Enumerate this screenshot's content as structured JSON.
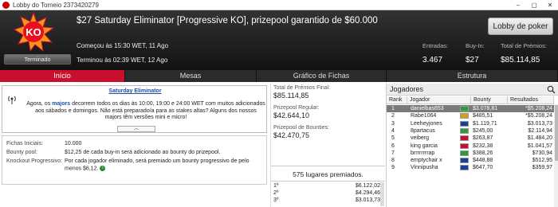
{
  "window": {
    "title": "Lobby do Torneio 2373420279",
    "min": "–",
    "max": "▢",
    "close": "✕"
  },
  "header": {
    "logo_text": "KO",
    "status_label": "Terminado",
    "title": "$27 Saturday Eliminator [Progressive KO], prizepool garantido de $60.000",
    "started": "Começou às 15:30 WET, 11 Ago",
    "ended": "Terminou às 02:39 WET, 12 Ago",
    "entries_label": "Entradas:",
    "entries_value": "3.467",
    "buyin_label": "Buy-In:",
    "buyin_value": "$27",
    "total_label": "Total de Prémios:",
    "total_value": "$85.114,85",
    "lobby_button": "Lobby de poker"
  },
  "tabs": [
    {
      "label": "Início",
      "active": true
    },
    {
      "label": "Mesas",
      "active": false
    },
    {
      "label": "Gráfico de Fichas",
      "active": false
    },
    {
      "label": "Estrutura",
      "active": false
    }
  ],
  "news": {
    "title": "Saturday Eliminator",
    "text_pre": "Agora, os ",
    "text_link": "majors",
    "text_post": " decorrem todos os dias às 10:00, 19:00 e 24:00 WET com muitos adicionados aos sábados e domingos. Não está preparado/a para as stakes altas? Alguns dos nossos majors têm versões mini e micro!",
    "collapse_glyph": "︿"
  },
  "info": {
    "chips_label": "Fichas Iniciais:",
    "chips_value": "10.000",
    "bounty_label": "Bounty pool:",
    "bounty_value": "$12,25 de cada buy-in será adicionado ao bounty do prizepool.",
    "ko_label": "Knockout Progressivo:",
    "ko_value": "Por cada jogador eliminado, será premiado um bounty progressivo de pelo menos $6,12."
  },
  "prizes": {
    "final_label": "Total de Prémios Final:",
    "final_value": "$85.114,85",
    "regular_label": "Prizepool Regular:",
    "regular_value": "$42.644,10",
    "bounties_label": "Prizepool de Bounties:",
    "bounties_value": "$42.470,75",
    "places_text": "575 lugares premiados.",
    "rows": [
      {
        "place": "1º",
        "amount": "$6.122,02"
      },
      {
        "place": "2º",
        "amount": "$4.294,46"
      },
      {
        "place": "3º",
        "amount": "$3.013,73"
      }
    ]
  },
  "players": {
    "panel_title": "Jogadores",
    "columns": [
      "Rank",
      "Jogador",
      "Bounty",
      "Resultados"
    ],
    "rows": [
      {
        "rank": "1",
        "name": "danielbas653",
        "bounty": "$3.078,81",
        "result": "*$5.208,24",
        "flag": "#2a9d3a"
      },
      {
        "rank": "2",
        "name": "Rabe1064",
        "bounty": "$485,51",
        "result": "*$5.208,24",
        "flag": "#d4a017"
      },
      {
        "rank": "3",
        "name": "Leeheyjones",
        "bounty": "$1.119,71",
        "result": "$3.013,73",
        "flag": "#1a3f9a"
      },
      {
        "rank": "4",
        "name": "8partacus",
        "bounty": "$245,00",
        "result": "$2.114,94",
        "flag": "#2a9d3a"
      },
      {
        "rank": "5",
        "name": "veiberg",
        "bounty": "$263,87",
        "result": "$1.484,20",
        "flag": "#c8102e"
      },
      {
        "rank": "6",
        "name": "king garcia",
        "bounty": "$232,38",
        "result": "$1.041,57",
        "flag": "#c8102e"
      },
      {
        "rank": "7",
        "name": "brrrrrrrrap",
        "bounty": "$388,26",
        "result": "$730,94",
        "flag": "#2a9d3a"
      },
      {
        "rank": "8",
        "name": "emptychair x",
        "bounty": "$448,88",
        "result": "$512,95",
        "flag": "#1a3f9a"
      },
      {
        "rank": "9",
        "name": "Vinnipusha",
        "bounty": "$647,70",
        "result": "$359,97",
        "flag": "#1a3f9a"
      }
    ]
  }
}
